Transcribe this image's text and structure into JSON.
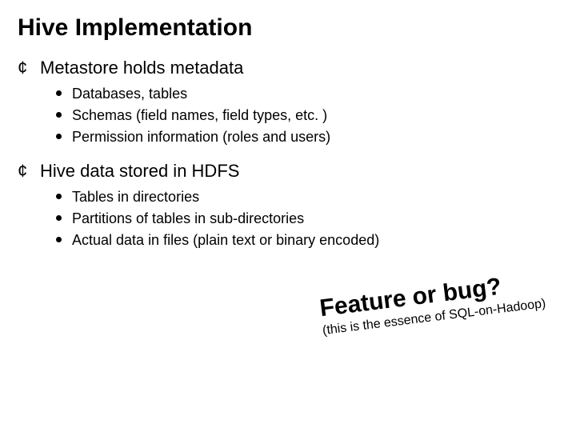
{
  "title": "Hive Implementation",
  "points": [
    {
      "text": "Metastore holds metadata",
      "sub": [
        "Databases, tables",
        "Schemas (field names, field types, etc. )",
        "Permission information (roles and users)"
      ]
    },
    {
      "text": "Hive data stored in HDFS",
      "sub": [
        "Tables in directories",
        "Partitions of tables in sub-directories",
        "Actual data in files (plain text or binary encoded)"
      ]
    }
  ],
  "callout": {
    "big": "Feature or bug?",
    "small": "(this is the essence of SQL-on-Hadoop)"
  }
}
